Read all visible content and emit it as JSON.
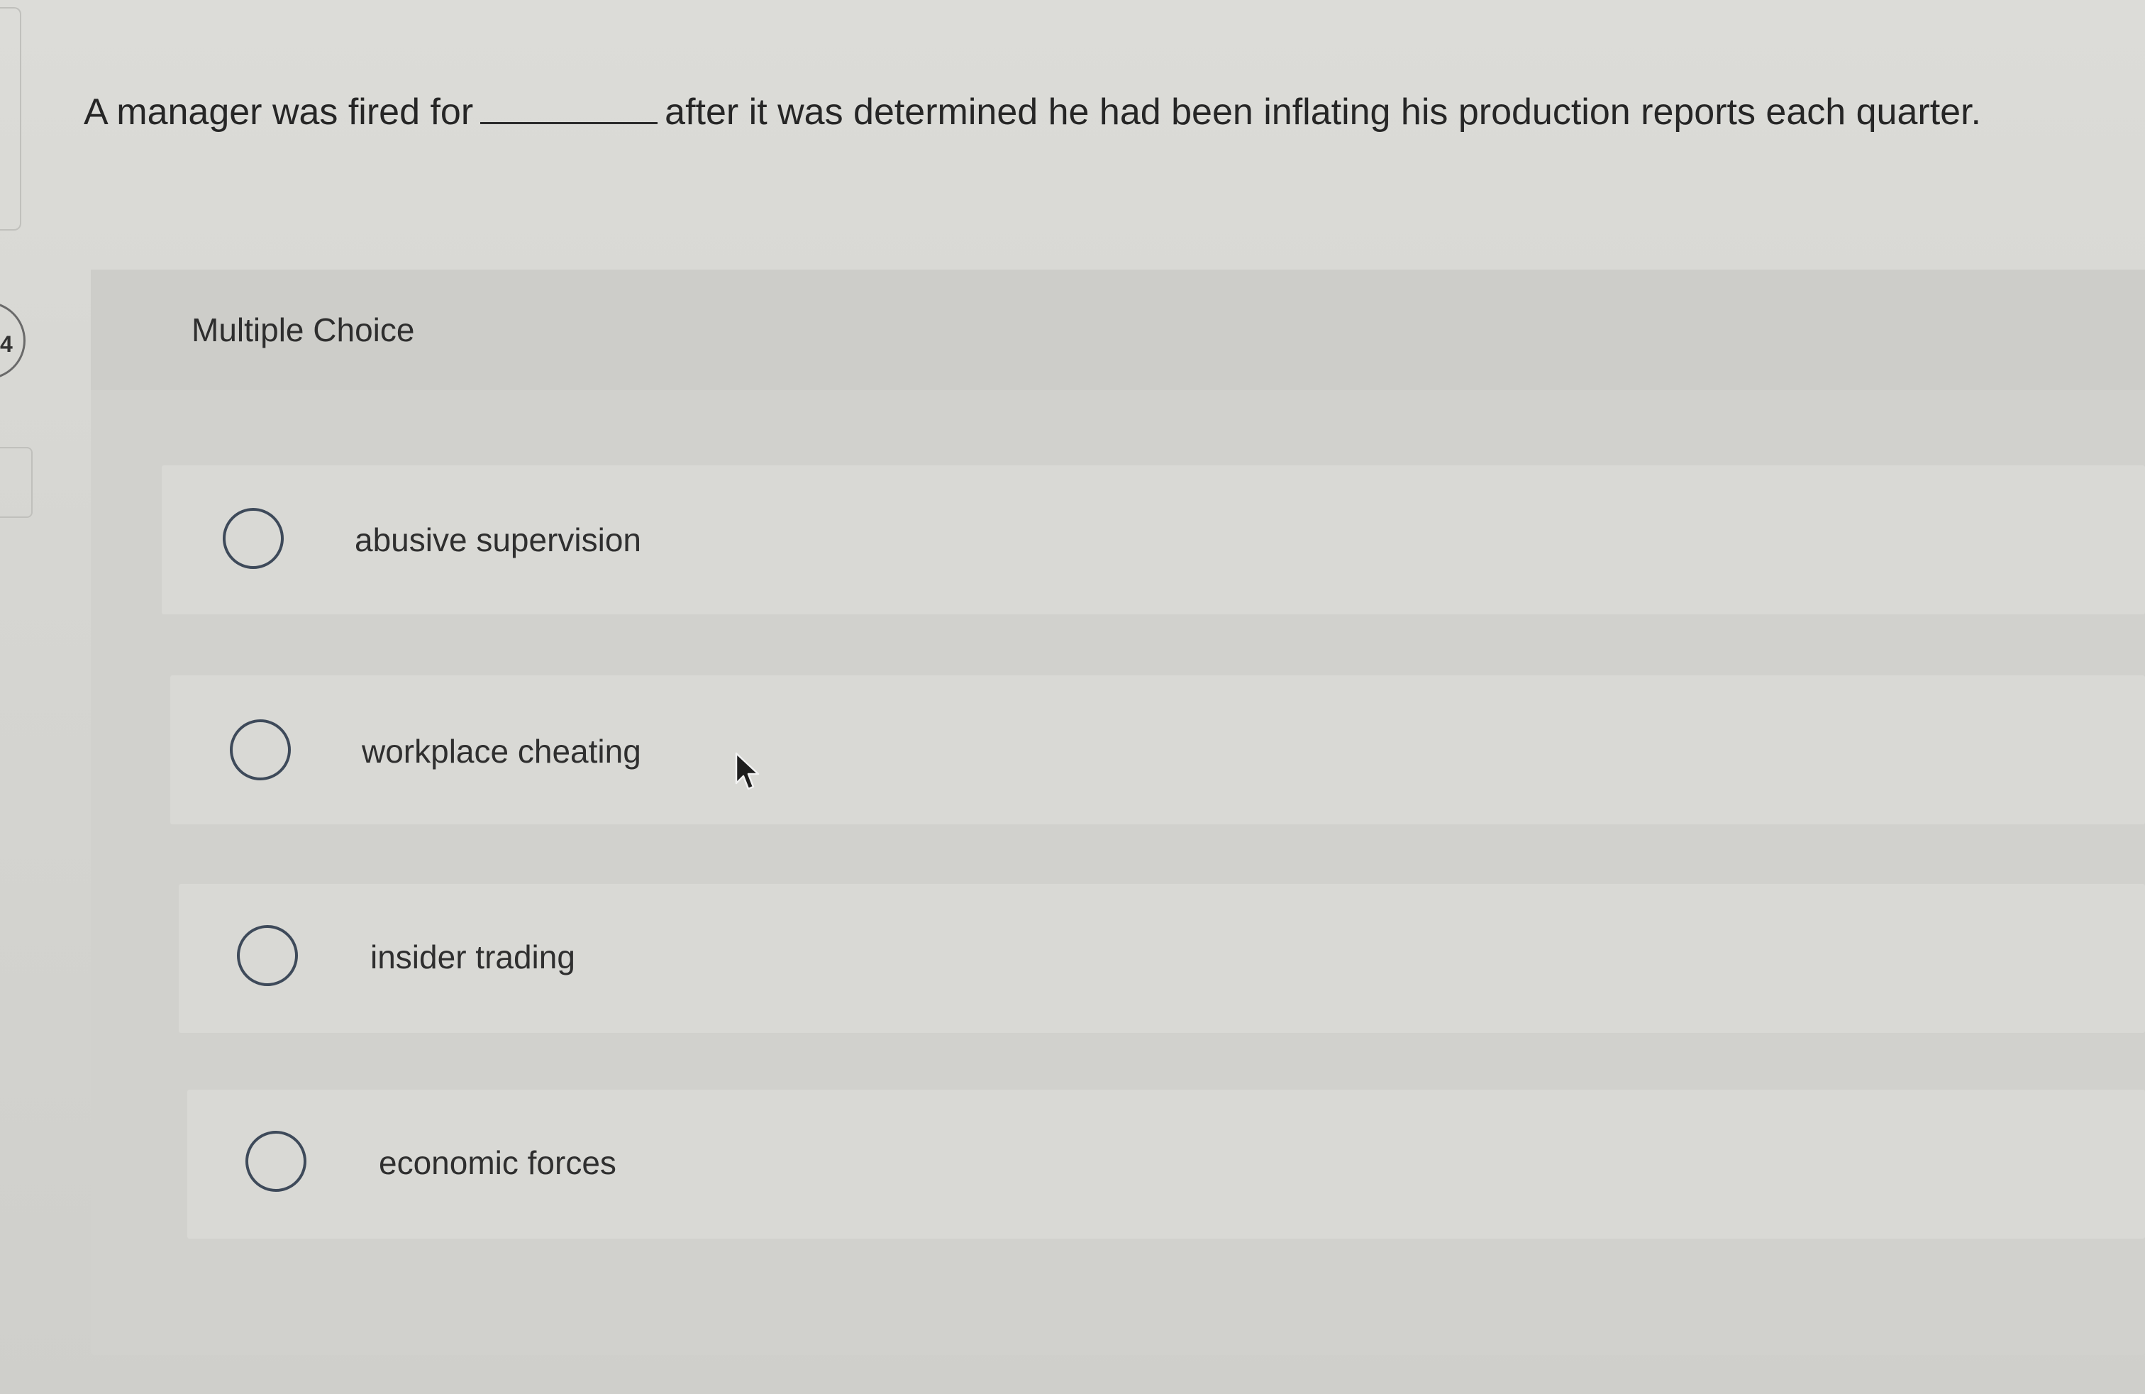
{
  "question": {
    "text_before": "A manager was fired for",
    "text_after": "after it was determined he had been inflating his production reports each quarter."
  },
  "sidebar": {
    "question_number": "4"
  },
  "card": {
    "type_label": "Multiple Choice",
    "options": [
      {
        "label": "abusive supervision",
        "selected": false
      },
      {
        "label": "workplace cheating",
        "selected": false
      },
      {
        "label": "insider trading",
        "selected": false
      },
      {
        "label": "economic forces",
        "selected": false
      }
    ]
  },
  "colors": {
    "background": "#d6d6d2",
    "card": "#d1d1cd",
    "option_row": "#d9d9d5",
    "radio_border": "#3e4a5a"
  }
}
